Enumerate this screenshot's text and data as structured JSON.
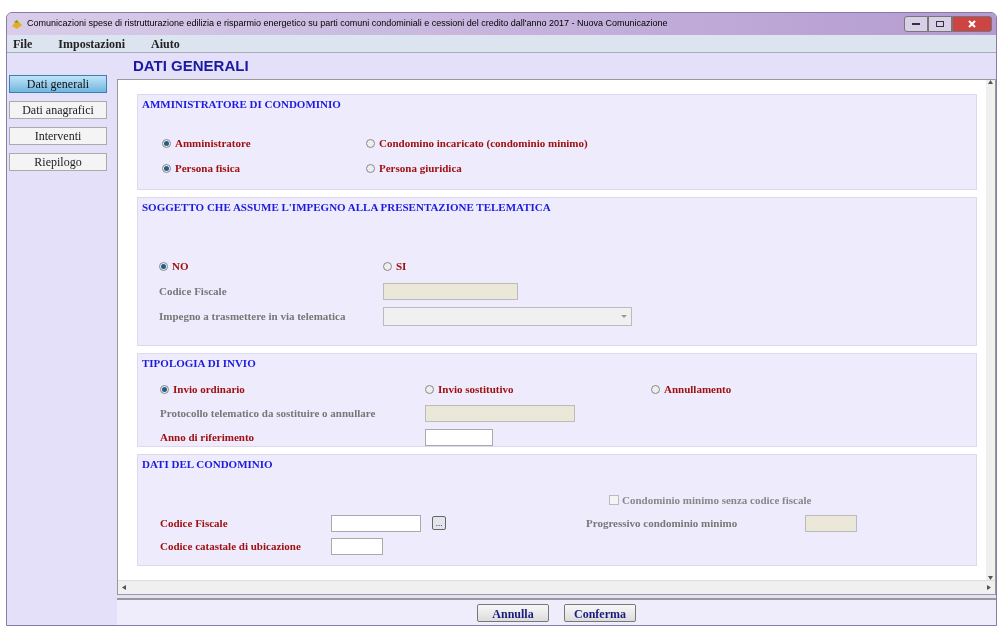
{
  "window": {
    "title": "Comunicazioni spese di ristrutturazione edilizia e risparmio energetico su parti comuni condominiali e cessioni del credito dall'anno 2017 - Nuova Comunicazione"
  },
  "menu": [
    "File",
    "Impostazioni",
    "Aiuto"
  ],
  "sidebar": {
    "items": [
      {
        "label": "Dati generali",
        "selected": true
      },
      {
        "label": "Dati anagrafici",
        "selected": false
      },
      {
        "label": "Interventi",
        "selected": false
      },
      {
        "label": "Riepilogo",
        "selected": false
      }
    ]
  },
  "page_title": "DATI GENERALI",
  "sections": [
    {
      "title": "AMMINISTRATORE DI CONDOMINIO",
      "rows": [
        {
          "items": [
            {
              "kind": "radio",
              "label": "Amministratore",
              "selected": true
            },
            {
              "kind": "radio",
              "label": "Condomino incaricato (condominio minimo)",
              "selected": false
            }
          ]
        },
        {
          "items": [
            {
              "kind": "radio",
              "label": "Persona fisica",
              "selected": true
            },
            {
              "kind": "radio",
              "label": "Persona giuridica",
              "selected": false
            }
          ]
        }
      ]
    },
    {
      "title": "SOGGETTO CHE ASSUME L'IMPEGNO ALLA PRESENTAZIONE TELEMATICA",
      "rows": [
        {
          "items": [
            {
              "kind": "radio",
              "label": "NO",
              "selected": true
            },
            {
              "kind": "radio",
              "label": "SI",
              "selected": false
            }
          ]
        },
        {
          "items": [
            {
              "kind": "label",
              "label": "Codice Fiscale",
              "disabled": true
            },
            {
              "kind": "field",
              "disabled": true
            }
          ]
        },
        {
          "items": [
            {
              "kind": "label",
              "label": "Impegno a trasmettere in via telematica",
              "disabled": true
            },
            {
              "kind": "select",
              "disabled": true
            }
          ]
        }
      ]
    },
    {
      "title": "TIPOLOGIA DI INVIO",
      "rows": [
        {
          "items": [
            {
              "kind": "radio",
              "label": "Invio ordinario",
              "selected": true
            },
            {
              "kind": "radio",
              "label": "Invio sostitutivo",
              "selected": false
            },
            {
              "kind": "radio",
              "label": "Annullamento",
              "selected": false
            }
          ]
        },
        {
          "items": [
            {
              "kind": "label",
              "label": "Protocollo telematico da sostituire o annullare",
              "disabled": true
            },
            {
              "kind": "field",
              "disabled": true
            }
          ]
        },
        {
          "items": [
            {
              "kind": "label",
              "label": "Anno di riferimento",
              "disabled": false
            },
            {
              "kind": "field",
              "disabled": false
            }
          ]
        }
      ]
    },
    {
      "title": "DATI DEL CONDOMINIO",
      "rows": [
        {
          "items": [
            {
              "kind": "checkbox",
              "label": "Condominio minimo senza codice fiscale",
              "checked": false,
              "disabled": true
            }
          ]
        },
        {
          "items": [
            {
              "kind": "label",
              "label": "Codice Fiscale",
              "disabled": false
            },
            {
              "kind": "field",
              "disabled": false
            },
            {
              "kind": "button",
              "label": "..."
            },
            {
              "kind": "label",
              "label": "Progressivo condominio minimo",
              "disabled": true
            },
            {
              "kind": "field",
              "disabled": true
            }
          ]
        },
        {
          "items": [
            {
              "kind": "label",
              "label": "Codice catastale di ubicazione",
              "disabled": false
            },
            {
              "kind": "field",
              "disabled": false
            }
          ]
        }
      ]
    }
  ],
  "buttons": [
    "Annulla",
    "Conferma"
  ]
}
